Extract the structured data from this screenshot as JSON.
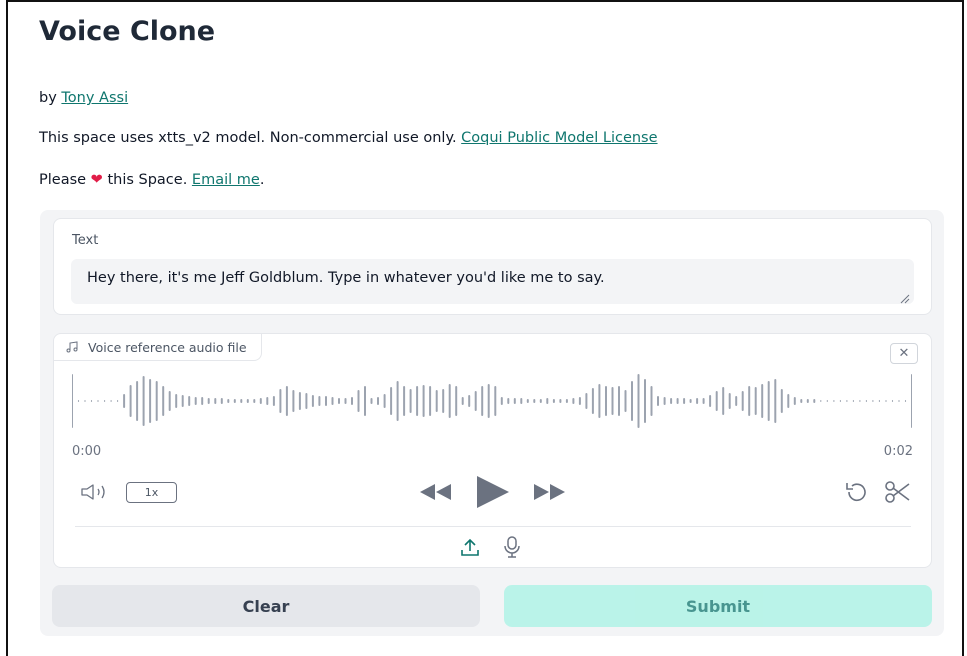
{
  "header": {
    "title": "Voice Clone",
    "by_prefix": "by",
    "author_link": "Tony Assi",
    "model_text": "This space uses xtts_v2 model. Non-commercial use only.",
    "license_link": "Coqui Public Model License",
    "please_prefix": "Please",
    "heart": "❤",
    "please_suffix": "this Space.",
    "email_link": "Email me",
    "period": "."
  },
  "text_input": {
    "label": "Text",
    "value": "Hey there, it's me Jeff Goldblum. Type in whatever you'd like me to say."
  },
  "audio": {
    "label": "Voice reference audio file",
    "time_start": "0:00",
    "time_end": "0:02",
    "speed": "1x",
    "waveform_color": "#9ca3af",
    "icons": {
      "label_icon": "music-note-icon",
      "close": "close-icon",
      "volume": "volume-icon",
      "rewind": "rewind-icon",
      "play": "play-icon",
      "forward": "fast-forward-icon",
      "undo": "undo-icon",
      "trim": "scissors-icon",
      "upload": "upload-icon",
      "mic": "microphone-icon"
    }
  },
  "buttons": {
    "clear": "Clear",
    "submit": "Submit"
  },
  "colors": {
    "accent": "#0f766e",
    "submit_bg": "#a7f3e4",
    "clear_bg": "#e5e7eb"
  }
}
